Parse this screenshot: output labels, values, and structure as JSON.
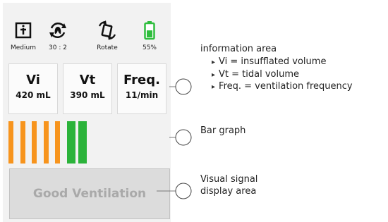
{
  "status_bar": {
    "items": [
      {
        "label": "Medium",
        "icon": "medium-mode-icon"
      },
      {
        "label": "30 : 2",
        "icon": "ratio-cycle-icon"
      },
      {
        "label": "Rotate",
        "icon": "rotate-icon"
      },
      {
        "label": "55%",
        "icon": "battery-icon",
        "level": 0.55
      }
    ],
    "colors": {
      "battery": "#2ebd3d"
    }
  },
  "info_boxes": [
    {
      "symbol": "Vi",
      "value": "420 mL"
    },
    {
      "symbol": "Vt",
      "value": "390 mL"
    },
    {
      "symbol": "Freq.",
      "value": "11/min"
    }
  ],
  "bar_graph": {
    "bars": [
      "orange",
      "orange",
      "orange",
      "orange",
      "orange",
      "green",
      "green"
    ],
    "colors": {
      "orange": "#f7941d",
      "green": "#2bb33a"
    }
  },
  "visual_signal": {
    "text": "Good Ventilation"
  },
  "annotations": {
    "information_area": {
      "title": "information area",
      "items": [
        "Vi = insufflated volume",
        "Vt = tidal volume",
        "Freq. = ventilation frequency"
      ]
    },
    "bar_graph": {
      "title": "Bar graph"
    },
    "visual_signal": {
      "title_line1": "Visual signal",
      "title_line2": "display area"
    }
  }
}
